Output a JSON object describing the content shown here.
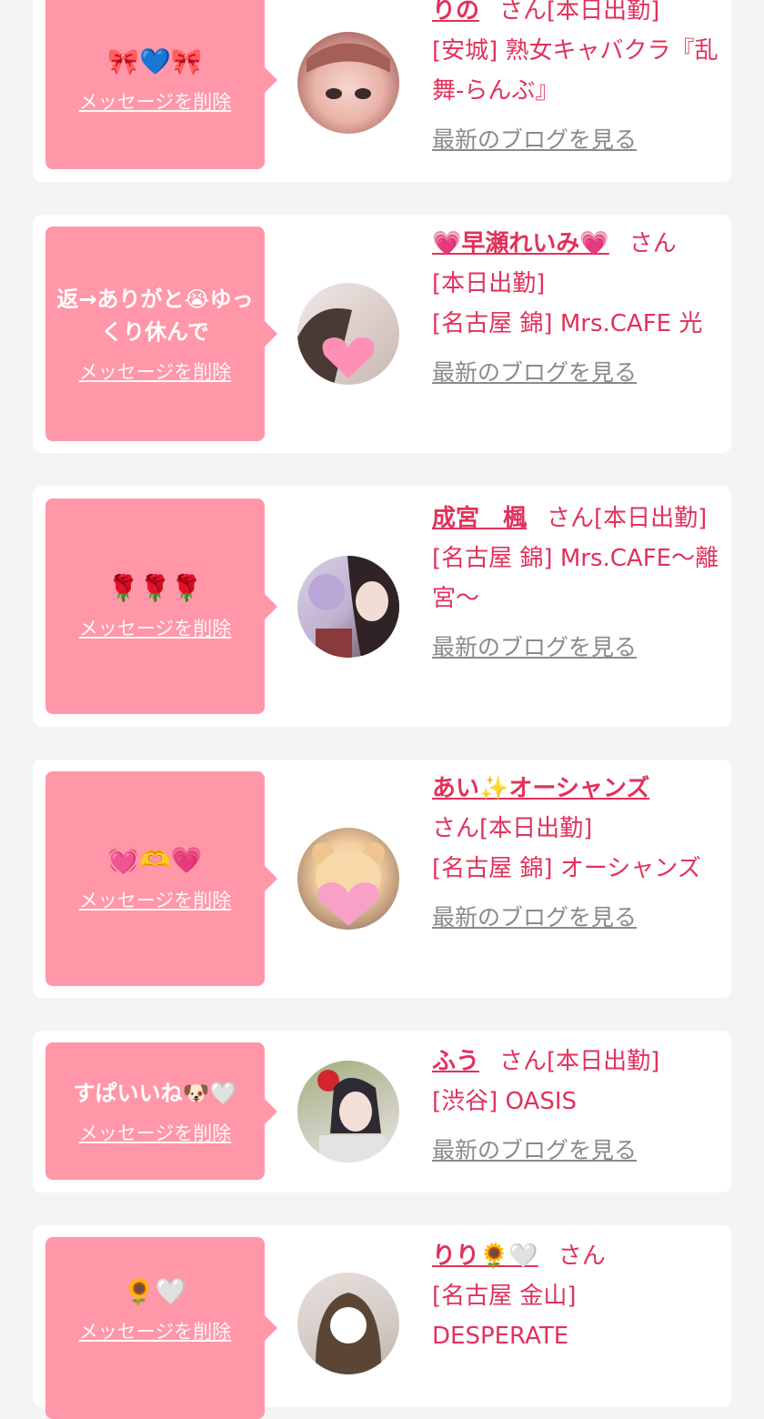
{
  "delete_label": "メッセージを削除",
  "blog_label": "最新のブログを見る",
  "san_label": "さん",
  "entries": [
    {
      "message": "🎀💙🎀",
      "name": "りの",
      "status": "[本日出勤]",
      "shop": "[安城] 熟女キャバクラ『乱舞-らんぶ』"
    },
    {
      "message": "返→ありがと😭ゆっくり休んで",
      "name": "💗早瀬れいみ💗",
      "status": "[本日出勤]",
      "shop": "[名古屋 錦] Mrs.CAFE 光"
    },
    {
      "message": "🌹🌹🌹",
      "name": "成宮　楓",
      "status": "[本日出勤]",
      "shop": "[名古屋 錦] Mrs.CAFE～離宮～"
    },
    {
      "message": "💓🫶💗",
      "name": "あい✨オーシャンズ",
      "status": "[本日出勤]",
      "shop": "[名古屋 錦] オーシャンズ"
    },
    {
      "message": "すぱいいね🐶🤍",
      "name": "ふう",
      "status": "[本日出勤]",
      "shop": "[渋谷] OASIS"
    },
    {
      "message": "🌻🤍",
      "name": "りり🌻🤍",
      "status": "",
      "shop": "[名古屋 金山] DESPERATE"
    }
  ]
}
